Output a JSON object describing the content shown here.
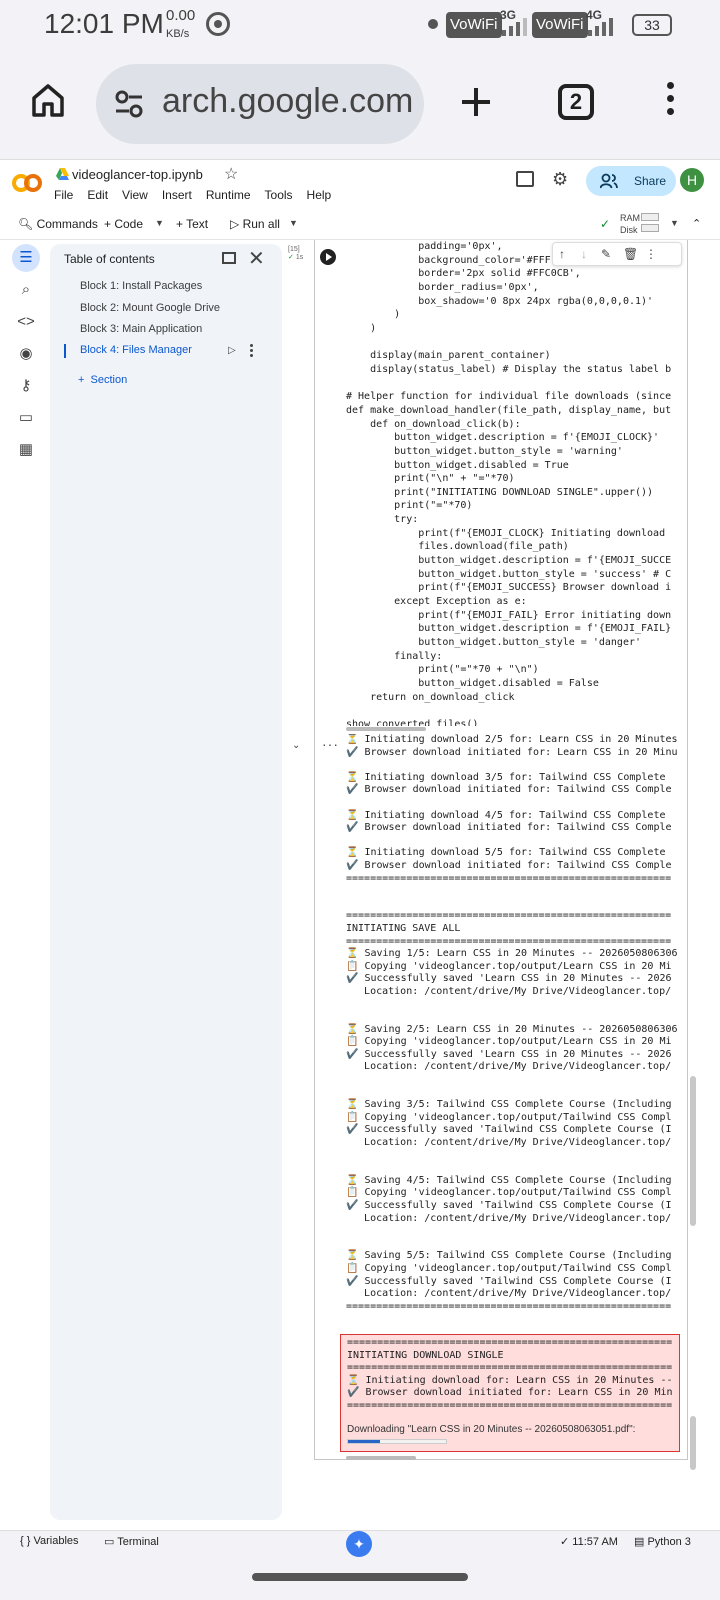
{
  "status": {
    "time": "12:01 PM",
    "speed": "0.00",
    "speed_unit": "KB/s",
    "vowifi1": "VoWiFi",
    "net1": "3G",
    "vowifi2": "VoWiFi",
    "net2": "4G",
    "battery": "33"
  },
  "browser": {
    "url": "arch.google.com",
    "tab_count": "2"
  },
  "colab": {
    "notebook_title": "videoglancer-top.ipynb",
    "menu": [
      "File",
      "Edit",
      "View",
      "Insert",
      "Runtime",
      "Tools",
      "Help"
    ],
    "share_label": "Share",
    "avatar_initial": "H",
    "toolbar": {
      "commands": "Commands",
      "code": "Code",
      "text": "Text",
      "run_all": "Run all",
      "ram": "RAM",
      "disk": "Disk"
    }
  },
  "toc": {
    "title": "Table of contents",
    "items": [
      "Block 1: Install Packages",
      "Block 2: Mount Google Drive",
      "Block 3: Main Application",
      "Block 4: Files Manager"
    ],
    "section_label": "Section"
  },
  "cell": {
    "exec_count": "[15]",
    "exec_time": "1s",
    "code_lines": [
      "            padding='0px',",
      "            background_color='#FFF",
      "            border='2px solid #FFC0CB',",
      "            border_radius='0px',",
      "            box_shadow='0 8px 24px rgba(0,0,0,0.1)'",
      "        )",
      "    )",
      "",
      "    display(main_parent_container)",
      "    display(status_label) # Display the status label b",
      "",
      "# Helper function for individual file downloads (since",
      "def make_download_handler(file_path, display_name, but",
      "    def on_download_click(b):",
      "        button_widget.description = f'{EMOJI_CLOCK}'",
      "        button_widget.button_style = 'warning'",
      "        button_widget.disabled = True",
      "        print(\"\\n\" + \"=\"*70)",
      "        print(\"INITIATING DOWNLOAD SINGLE\".upper())",
      "        print(\"=\"*70)",
      "        try:",
      "            print(f\"{EMOJI_CLOCK} Initiating download",
      "            files.download(file_path)",
      "            button_widget.description = f'{EMOJI_SUCCE",
      "            button_widget.button_style = 'success' # C",
      "            print(f\"{EMOJI_SUCCESS} Browser download i",
      "        except Exception as e:",
      "            print(f\"{EMOJI_FAIL} Error initiating down",
      "            button_widget.description = f'{EMOJI_FAIL}",
      "            button_widget.button_style = 'danger'",
      "        finally:",
      "            print(\"=\"*70 + \"\\n\")",
      "            button_widget.disabled = False",
      "    return on_download_click",
      "",
      "show_converted_files()"
    ],
    "output_lines": [
      "⏳ Initiating download 2/5 for: Learn CSS in 20 Minutes",
      "✔️ Browser download initiated for: Learn CSS in 20 Minu",
      "",
      "⏳ Initiating download 3/5 for: Tailwind CSS Complete",
      "✔️ Browser download initiated for: Tailwind CSS Comple",
      "",
      "⏳ Initiating download 4/5 for: Tailwind CSS Complete",
      "✔️ Browser download initiated for: Tailwind CSS Comple",
      "",
      "⏳ Initiating download 5/5 for: Tailwind CSS Complete",
      "✔️ Browser download initiated for: Tailwind CSS Comple",
      "======================================================",
      "",
      "",
      "======================================================",
      "INITIATING SAVE ALL",
      "======================================================",
      "⏳ Saving 1/5: Learn CSS in 20 Minutes -- 2026050806306",
      "📋 Copying 'videoglancer.top/output/Learn CSS in 20 Mi",
      "✔️ Successfully saved 'Learn CSS in 20 Minutes -- 2026",
      "   Location: /content/drive/My Drive/Videoglancer.top/",
      "",
      "",
      "⏳ Saving 2/5: Learn CSS in 20 Minutes -- 2026050806306",
      "📋 Copying 'videoglancer.top/output/Learn CSS in 20 Mi",
      "✔️ Successfully saved 'Learn CSS in 20 Minutes -- 2026",
      "   Location: /content/drive/My Drive/Videoglancer.top/",
      "",
      "",
      "⏳ Saving 3/5: Tailwind CSS Complete Course (Including",
      "📋 Copying 'videoglancer.top/output/Tailwind CSS Compl",
      "✔️ Successfully saved 'Tailwind CSS Complete Course (I",
      "   Location: /content/drive/My Drive/Videoglancer.top/",
      "",
      "",
      "⏳ Saving 4/5: Tailwind CSS Complete Course (Including",
      "📋 Copying 'videoglancer.top/output/Tailwind CSS Compl",
      "✔️ Successfully saved 'Tailwind CSS Complete Course (I",
      "   Location: /content/drive/My Drive/Videoglancer.top/",
      "",
      "",
      "⏳ Saving 5/5: Tailwind CSS Complete Course (Including",
      "📋 Copying 'videoglancer.top/output/Tailwind CSS Compl",
      "✔️ Successfully saved 'Tailwind CSS Complete Course (I",
      "   Location: /content/drive/My Drive/Videoglancer.top/",
      "======================================================"
    ],
    "error_lines": [
      "======================================================",
      "INITIATING DOWNLOAD SINGLE",
      "======================================================",
      "⏳ Initiating download for: Learn CSS in 20 Minutes --",
      "✔️ Browser download initiated for: Learn CSS in 20 Min",
      "======================================================"
    ],
    "download_label": "Downloading \"Learn CSS in 20 Minutes -- 20260508063051.pdf\":",
    "download_progress": 0.33
  },
  "bottom": {
    "variables": "Variables",
    "terminal": "Terminal",
    "time": "11:57 AM",
    "runtime": "Python 3"
  }
}
